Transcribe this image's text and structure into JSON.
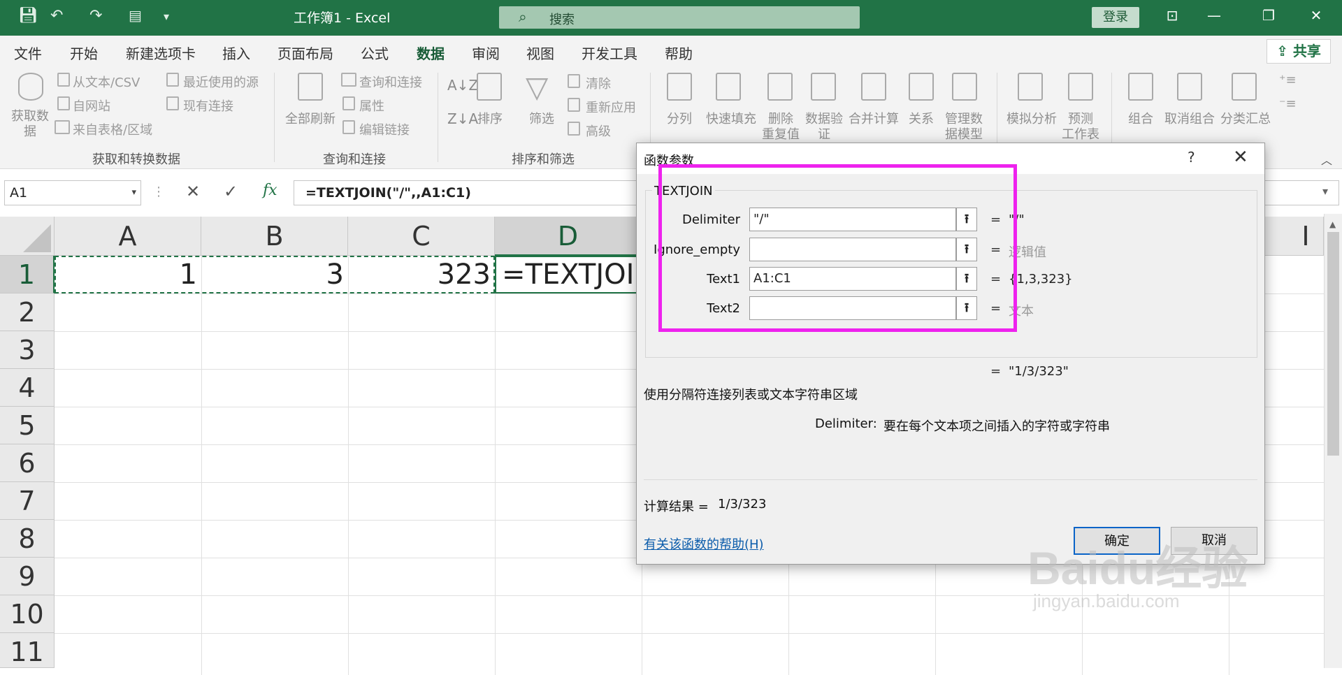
{
  "window": {
    "title": "工作簿1  -  Excel",
    "search_placeholder": "搜索",
    "login_label": "登录"
  },
  "ribbon": {
    "tabs": [
      "文件",
      "开始",
      "新建选项卡",
      "插入",
      "页面布局",
      "公式",
      "数据",
      "审阅",
      "视图",
      "开发工具",
      "帮助"
    ],
    "active_tab": "数据",
    "share_label": "共享",
    "get_data": {
      "big_button": "获取数据",
      "from_text_csv": "从文本/CSV",
      "from_web": "自网站",
      "from_table": "来自表格/区域",
      "recent_sources": "最近使用的源",
      "existing_connections": "现有连接",
      "group_label": "获取和转换数据"
    },
    "queries": {
      "refresh_all": "全部刷新",
      "queries_connections": "查询和连接",
      "properties": "属性",
      "edit_links": "编辑链接",
      "group_label": "查询和连接"
    },
    "sort_filter": {
      "sort": "排序",
      "filter": "筛选",
      "clear": "清除",
      "reapply": "重新应用",
      "advanced": "高级",
      "group_label": "排序和筛选"
    },
    "data_tools": {
      "text_to_columns": "分列",
      "flash_fill": "快速填充",
      "remove_duplicates_1": "删除",
      "remove_duplicates_2": "重复值",
      "validation_1": "数据验",
      "validation_2": "证",
      "consolidate": "合并计算",
      "relationships": "关系",
      "data_model_1": "管理数",
      "data_model_2": "据模型"
    },
    "forecast": {
      "what_if": "模拟分析",
      "forecast_1": "预测",
      "forecast_2": "工作表"
    },
    "outline": {
      "group": "组合",
      "ungroup": "取消组合",
      "subtotal": "分类汇总"
    }
  },
  "formula_bar": {
    "name_box": "A1",
    "formula": "=TEXTJOIN(\"/\",,A1:C1)",
    "fx": "fx"
  },
  "sheet": {
    "columns": [
      "A",
      "B",
      "C",
      "D",
      "I"
    ],
    "rows": [
      "1",
      "2",
      "3",
      "4",
      "5",
      "6",
      "7",
      "8",
      "9",
      "10",
      "11"
    ],
    "cells": {
      "A1": "1",
      "B1": "3",
      "C1": "323",
      "D1": "=TEXTJOIN"
    }
  },
  "dialog": {
    "title": "函数参数",
    "help_glyph": "?",
    "close_glyph": "✕",
    "function_name": "TEXTJOIN",
    "args": [
      {
        "label": "Delimiter",
        "value": "\"/\"",
        "result": "\"/\""
      },
      {
        "label": "Ignore_empty",
        "value": "",
        "result": "逻辑值",
        "result_gray": true
      },
      {
        "label": "Text1",
        "value": "A1:C1",
        "result": "{1,3,323}"
      },
      {
        "label": "Text2",
        "value": "",
        "result": "文本",
        "result_gray": true
      }
    ],
    "overall_result": "\"1/3/323\"",
    "description": "使用分隔符连接列表或文本字符串区域",
    "param_name": "Delimiter:",
    "param_desc": "要在每个文本项之间插入的字符或字符串",
    "calc_result_label": "计算结果 =",
    "calc_result_value": "1/3/323",
    "help_link": "有关该函数的帮助(H)",
    "ok_label": "确定",
    "cancel_label": "取消"
  },
  "colors": {
    "excel_green": "#217346",
    "highlight_box": "#ee22ee"
  },
  "watermark": {
    "brand": "Baidu经验",
    "url": "jingyan.baidu.com"
  }
}
